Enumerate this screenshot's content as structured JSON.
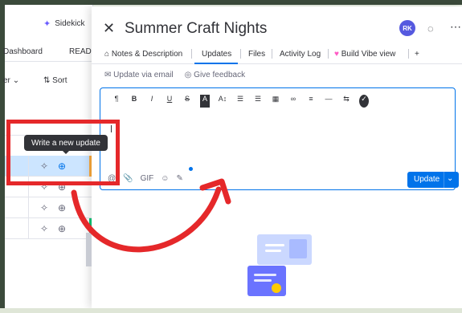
{
  "board": {
    "sidekick_label": "Sidekick",
    "tab_dashboard": "Dashboard",
    "tab_read": "READ",
    "filter_label": "er",
    "sort_label": "Sort"
  },
  "tooltip": "Write a new update",
  "panel": {
    "title": "Summer Craft Nights",
    "avatar_initials": "RK",
    "tabs": [
      {
        "label": "Notes & Description"
      },
      {
        "label": "Updates"
      },
      {
        "label": "Files"
      },
      {
        "label": "Activity Log"
      },
      {
        "label": "Build Vibe view"
      }
    ],
    "add_tab": "+",
    "update_via_email": "Update via email",
    "give_feedback": "Give feedback",
    "toolbar": [
      "¶",
      "B",
      "I",
      "U",
      "S",
      "A",
      "A↕",
      "☰",
      "☰",
      "▦",
      "∞",
      "≡",
      "—",
      "⇆",
      "✓"
    ],
    "bottom_tools": [
      "@",
      "📎",
      "GIF",
      "☺",
      "✎"
    ],
    "update_button": "Update"
  },
  "colors": {
    "accent": "#0073ea",
    "highlight": "#e5282a",
    "avatar": "#5559df"
  }
}
